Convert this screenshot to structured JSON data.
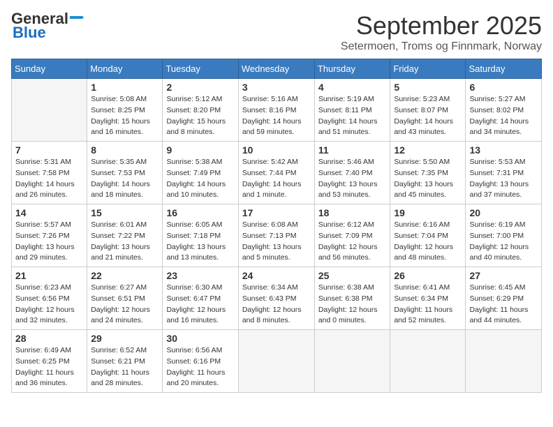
{
  "logo": {
    "general": "General",
    "blue": "Blue",
    "arrow_color": "#1a8fd1"
  },
  "header": {
    "month": "September 2025",
    "location": "Setermoen, Troms og Finnmark, Norway"
  },
  "weekdays": [
    "Sunday",
    "Monday",
    "Tuesday",
    "Wednesday",
    "Thursday",
    "Friday",
    "Saturday"
  ],
  "weeks": [
    [
      {
        "day": "",
        "info": ""
      },
      {
        "day": "1",
        "info": "Sunrise: 5:08 AM\nSunset: 8:25 PM\nDaylight: 15 hours\nand 16 minutes."
      },
      {
        "day": "2",
        "info": "Sunrise: 5:12 AM\nSunset: 8:20 PM\nDaylight: 15 hours\nand 8 minutes."
      },
      {
        "day": "3",
        "info": "Sunrise: 5:16 AM\nSunset: 8:16 PM\nDaylight: 14 hours\nand 59 minutes."
      },
      {
        "day": "4",
        "info": "Sunrise: 5:19 AM\nSunset: 8:11 PM\nDaylight: 14 hours\nand 51 minutes."
      },
      {
        "day": "5",
        "info": "Sunrise: 5:23 AM\nSunset: 8:07 PM\nDaylight: 14 hours\nand 43 minutes."
      },
      {
        "day": "6",
        "info": "Sunrise: 5:27 AM\nSunset: 8:02 PM\nDaylight: 14 hours\nand 34 minutes."
      }
    ],
    [
      {
        "day": "7",
        "info": "Sunrise: 5:31 AM\nSunset: 7:58 PM\nDaylight: 14 hours\nand 26 minutes."
      },
      {
        "day": "8",
        "info": "Sunrise: 5:35 AM\nSunset: 7:53 PM\nDaylight: 14 hours\nand 18 minutes."
      },
      {
        "day": "9",
        "info": "Sunrise: 5:38 AM\nSunset: 7:49 PM\nDaylight: 14 hours\nand 10 minutes."
      },
      {
        "day": "10",
        "info": "Sunrise: 5:42 AM\nSunset: 7:44 PM\nDaylight: 14 hours\nand 1 minute."
      },
      {
        "day": "11",
        "info": "Sunrise: 5:46 AM\nSunset: 7:40 PM\nDaylight: 13 hours\nand 53 minutes."
      },
      {
        "day": "12",
        "info": "Sunrise: 5:50 AM\nSunset: 7:35 PM\nDaylight: 13 hours\nand 45 minutes."
      },
      {
        "day": "13",
        "info": "Sunrise: 5:53 AM\nSunset: 7:31 PM\nDaylight: 13 hours\nand 37 minutes."
      }
    ],
    [
      {
        "day": "14",
        "info": "Sunrise: 5:57 AM\nSunset: 7:26 PM\nDaylight: 13 hours\nand 29 minutes."
      },
      {
        "day": "15",
        "info": "Sunrise: 6:01 AM\nSunset: 7:22 PM\nDaylight: 13 hours\nand 21 minutes."
      },
      {
        "day": "16",
        "info": "Sunrise: 6:05 AM\nSunset: 7:18 PM\nDaylight: 13 hours\nand 13 minutes."
      },
      {
        "day": "17",
        "info": "Sunrise: 6:08 AM\nSunset: 7:13 PM\nDaylight: 13 hours\nand 5 minutes."
      },
      {
        "day": "18",
        "info": "Sunrise: 6:12 AM\nSunset: 7:09 PM\nDaylight: 12 hours\nand 56 minutes."
      },
      {
        "day": "19",
        "info": "Sunrise: 6:16 AM\nSunset: 7:04 PM\nDaylight: 12 hours\nand 48 minutes."
      },
      {
        "day": "20",
        "info": "Sunrise: 6:19 AM\nSunset: 7:00 PM\nDaylight: 12 hours\nand 40 minutes."
      }
    ],
    [
      {
        "day": "21",
        "info": "Sunrise: 6:23 AM\nSunset: 6:56 PM\nDaylight: 12 hours\nand 32 minutes."
      },
      {
        "day": "22",
        "info": "Sunrise: 6:27 AM\nSunset: 6:51 PM\nDaylight: 12 hours\nand 24 minutes."
      },
      {
        "day": "23",
        "info": "Sunrise: 6:30 AM\nSunset: 6:47 PM\nDaylight: 12 hours\nand 16 minutes."
      },
      {
        "day": "24",
        "info": "Sunrise: 6:34 AM\nSunset: 6:43 PM\nDaylight: 12 hours\nand 8 minutes."
      },
      {
        "day": "25",
        "info": "Sunrise: 6:38 AM\nSunset: 6:38 PM\nDaylight: 12 hours\nand 0 minutes."
      },
      {
        "day": "26",
        "info": "Sunrise: 6:41 AM\nSunset: 6:34 PM\nDaylight: 11 hours\nand 52 minutes."
      },
      {
        "day": "27",
        "info": "Sunrise: 6:45 AM\nSunset: 6:29 PM\nDaylight: 11 hours\nand 44 minutes."
      }
    ],
    [
      {
        "day": "28",
        "info": "Sunrise: 6:49 AM\nSunset: 6:25 PM\nDaylight: 11 hours\nand 36 minutes."
      },
      {
        "day": "29",
        "info": "Sunrise: 6:52 AM\nSunset: 6:21 PM\nDaylight: 11 hours\nand 28 minutes."
      },
      {
        "day": "30",
        "info": "Sunrise: 6:56 AM\nSunset: 6:16 PM\nDaylight: 11 hours\nand 20 minutes."
      },
      {
        "day": "",
        "info": ""
      },
      {
        "day": "",
        "info": ""
      },
      {
        "day": "",
        "info": ""
      },
      {
        "day": "",
        "info": ""
      }
    ]
  ]
}
